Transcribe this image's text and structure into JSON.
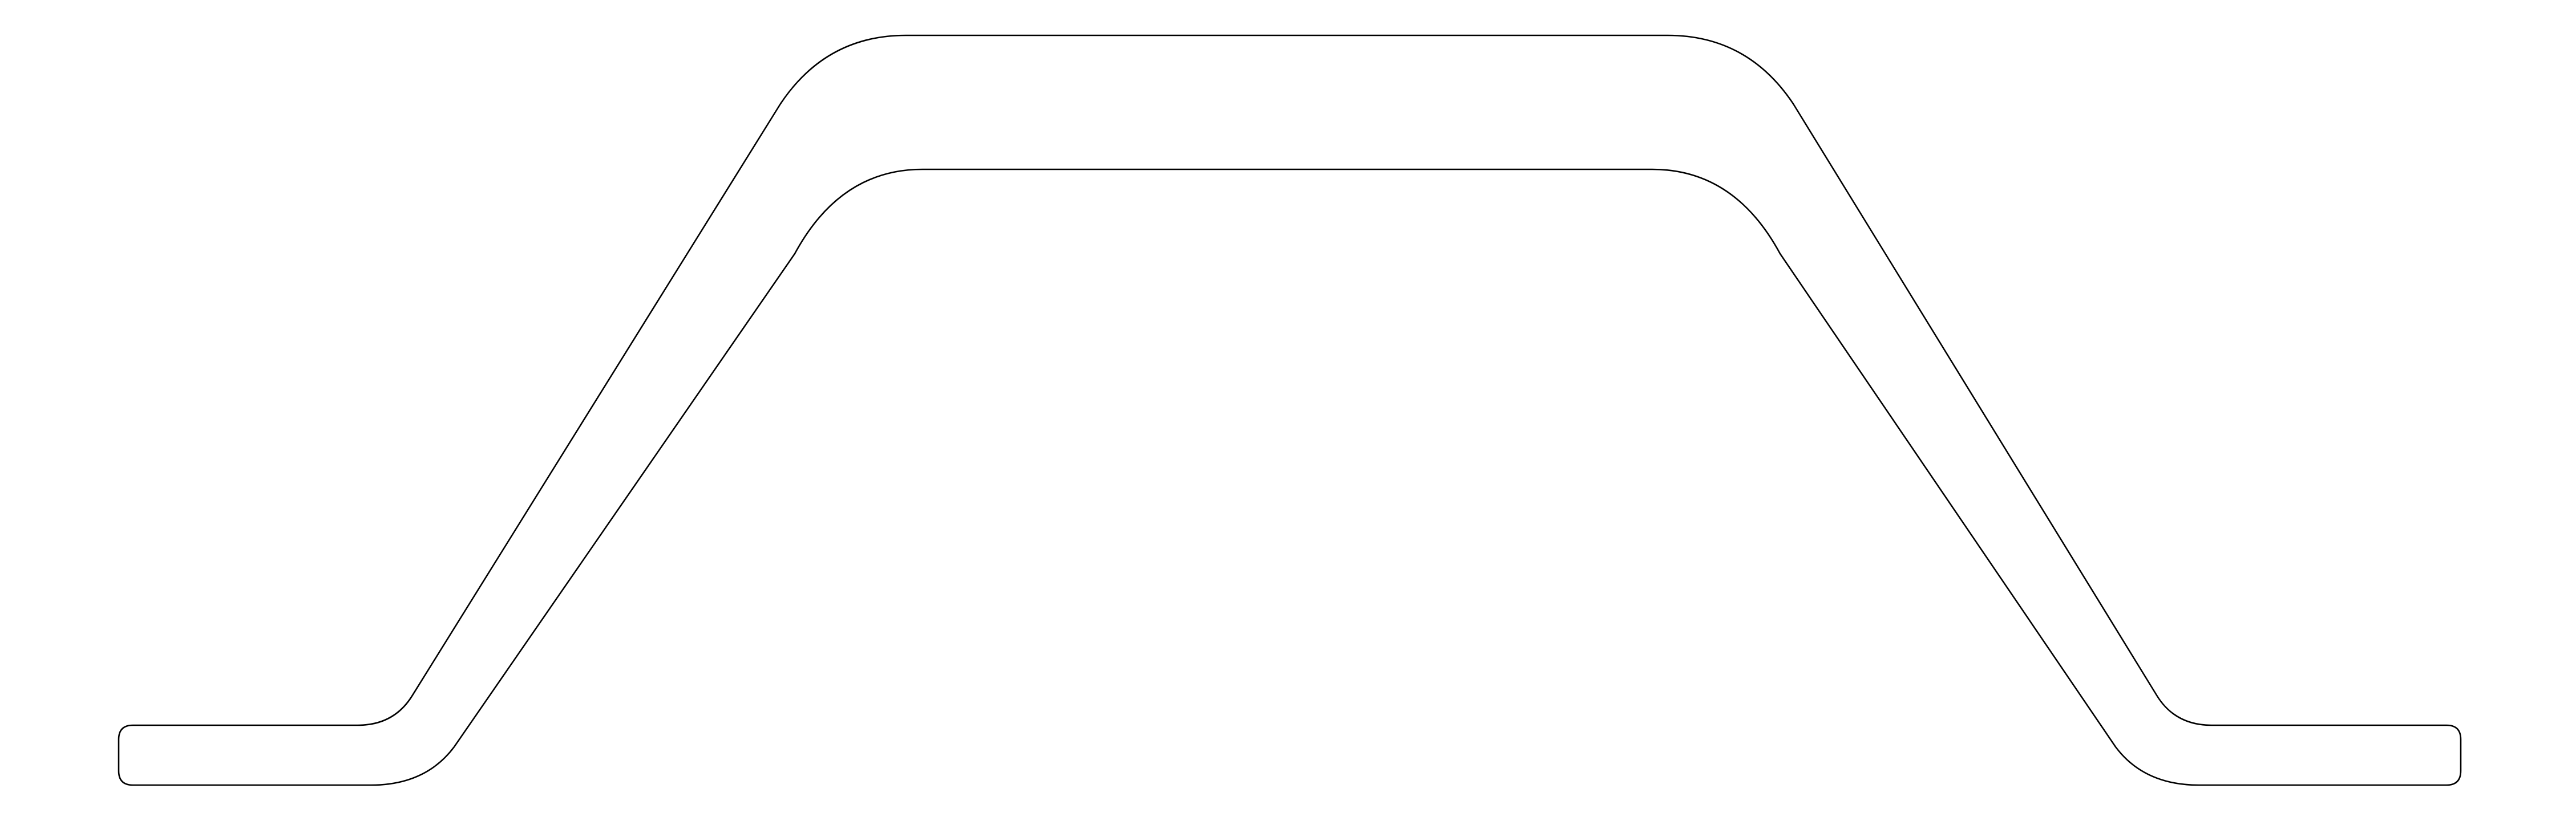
{
  "drawing": {
    "background_color": "#ffffff",
    "stroke_color": "#000000"
  }
}
